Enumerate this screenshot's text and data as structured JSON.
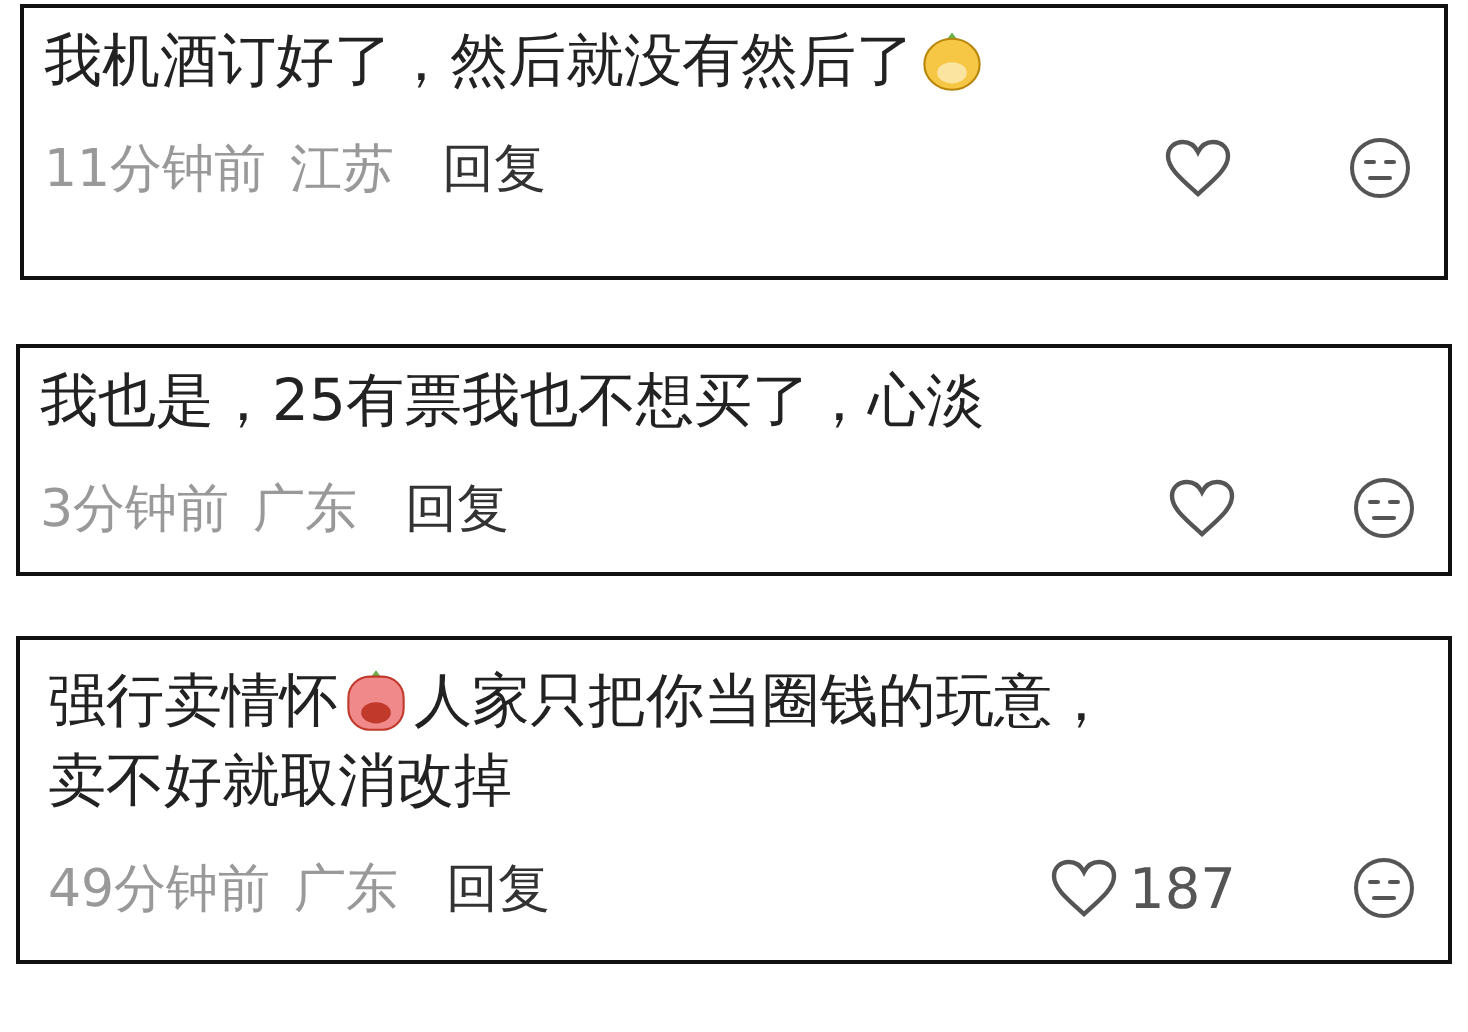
{
  "comments": [
    {
      "lines": [
        [
          {
            "kind": "text",
            "text": "我机酒订好了，然后就没有然后了"
          },
          {
            "kind": "mask-emoji"
          }
        ]
      ],
      "time": "11分钟前",
      "location": "江苏",
      "reply": "回复",
      "liked": false
    },
    {
      "lines": [
        [
          {
            "kind": "text",
            "text": "我也是，25有票我也不想买了，心淡"
          }
        ]
      ],
      "time": "3分钟前",
      "location": "广东",
      "reply": "回复",
      "liked": false
    },
    {
      "lines": [
        [
          {
            "kind": "text",
            "text": "强行卖情怀"
          },
          {
            "kind": "cry-emoji"
          },
          {
            "kind": "text",
            "text": "人家只把你当圈钱的玩意，"
          }
        ],
        [
          {
            "kind": "text",
            "text": "卖不好就取消改掉"
          }
        ]
      ],
      "time": "49分钟前",
      "location": "广东",
      "reply": "回复",
      "liked": false,
      "likes": "187"
    }
  ]
}
